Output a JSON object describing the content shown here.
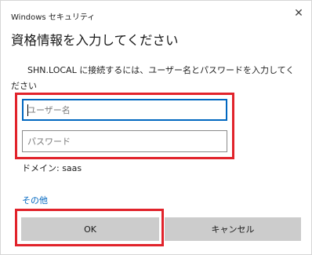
{
  "window": {
    "app_name": "Windows セキュリティ",
    "close_glyph": "✕"
  },
  "dialog": {
    "title": "資格情報を入力してください",
    "message": "SHN.LOCAL に接続するには、ユーザー名とパスワードを入力してください",
    "username": {
      "value": "",
      "placeholder": "ユーザー名"
    },
    "password": {
      "value": "",
      "placeholder": "パスワード"
    },
    "domain_text": "ドメイン: saas",
    "more_choices": "その他"
  },
  "buttons": {
    "ok": "OK",
    "cancel": "キャンセル"
  },
  "annotations": {
    "highlight_color": "#e1232b"
  },
  "colors": {
    "accent": "#0067c0",
    "button_bg": "#cccccc"
  }
}
